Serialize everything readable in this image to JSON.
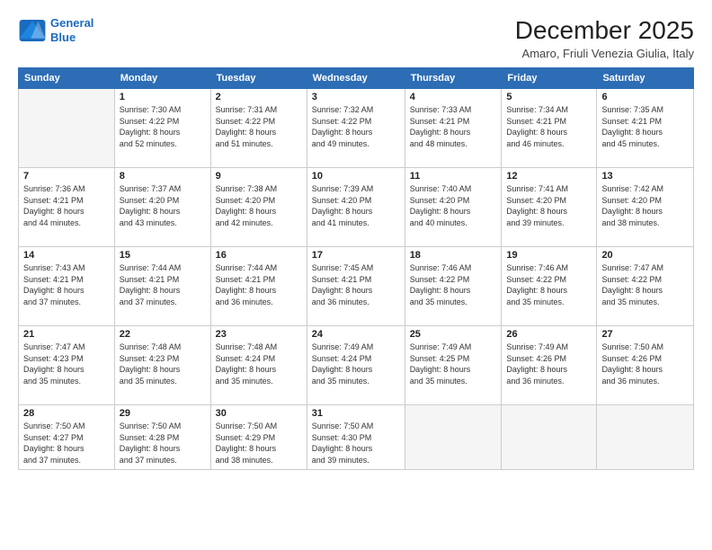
{
  "header": {
    "logo_line1": "General",
    "logo_line2": "Blue",
    "month": "December 2025",
    "location": "Amaro, Friuli Venezia Giulia, Italy"
  },
  "days_of_week": [
    "Sunday",
    "Monday",
    "Tuesday",
    "Wednesday",
    "Thursday",
    "Friday",
    "Saturday"
  ],
  "weeks": [
    [
      {
        "day": "",
        "info": ""
      },
      {
        "day": "1",
        "info": "Sunrise: 7:30 AM\nSunset: 4:22 PM\nDaylight: 8 hours\nand 52 minutes."
      },
      {
        "day": "2",
        "info": "Sunrise: 7:31 AM\nSunset: 4:22 PM\nDaylight: 8 hours\nand 51 minutes."
      },
      {
        "day": "3",
        "info": "Sunrise: 7:32 AM\nSunset: 4:22 PM\nDaylight: 8 hours\nand 49 minutes."
      },
      {
        "day": "4",
        "info": "Sunrise: 7:33 AM\nSunset: 4:21 PM\nDaylight: 8 hours\nand 48 minutes."
      },
      {
        "day": "5",
        "info": "Sunrise: 7:34 AM\nSunset: 4:21 PM\nDaylight: 8 hours\nand 46 minutes."
      },
      {
        "day": "6",
        "info": "Sunrise: 7:35 AM\nSunset: 4:21 PM\nDaylight: 8 hours\nand 45 minutes."
      }
    ],
    [
      {
        "day": "7",
        "info": "Sunrise: 7:36 AM\nSunset: 4:21 PM\nDaylight: 8 hours\nand 44 minutes."
      },
      {
        "day": "8",
        "info": "Sunrise: 7:37 AM\nSunset: 4:20 PM\nDaylight: 8 hours\nand 43 minutes."
      },
      {
        "day": "9",
        "info": "Sunrise: 7:38 AM\nSunset: 4:20 PM\nDaylight: 8 hours\nand 42 minutes."
      },
      {
        "day": "10",
        "info": "Sunrise: 7:39 AM\nSunset: 4:20 PM\nDaylight: 8 hours\nand 41 minutes."
      },
      {
        "day": "11",
        "info": "Sunrise: 7:40 AM\nSunset: 4:20 PM\nDaylight: 8 hours\nand 40 minutes."
      },
      {
        "day": "12",
        "info": "Sunrise: 7:41 AM\nSunset: 4:20 PM\nDaylight: 8 hours\nand 39 minutes."
      },
      {
        "day": "13",
        "info": "Sunrise: 7:42 AM\nSunset: 4:20 PM\nDaylight: 8 hours\nand 38 minutes."
      }
    ],
    [
      {
        "day": "14",
        "info": "Sunrise: 7:43 AM\nSunset: 4:21 PM\nDaylight: 8 hours\nand 37 minutes."
      },
      {
        "day": "15",
        "info": "Sunrise: 7:44 AM\nSunset: 4:21 PM\nDaylight: 8 hours\nand 37 minutes."
      },
      {
        "day": "16",
        "info": "Sunrise: 7:44 AM\nSunset: 4:21 PM\nDaylight: 8 hours\nand 36 minutes."
      },
      {
        "day": "17",
        "info": "Sunrise: 7:45 AM\nSunset: 4:21 PM\nDaylight: 8 hours\nand 36 minutes."
      },
      {
        "day": "18",
        "info": "Sunrise: 7:46 AM\nSunset: 4:22 PM\nDaylight: 8 hours\nand 35 minutes."
      },
      {
        "day": "19",
        "info": "Sunrise: 7:46 AM\nSunset: 4:22 PM\nDaylight: 8 hours\nand 35 minutes."
      },
      {
        "day": "20",
        "info": "Sunrise: 7:47 AM\nSunset: 4:22 PM\nDaylight: 8 hours\nand 35 minutes."
      }
    ],
    [
      {
        "day": "21",
        "info": "Sunrise: 7:47 AM\nSunset: 4:23 PM\nDaylight: 8 hours\nand 35 minutes."
      },
      {
        "day": "22",
        "info": "Sunrise: 7:48 AM\nSunset: 4:23 PM\nDaylight: 8 hours\nand 35 minutes."
      },
      {
        "day": "23",
        "info": "Sunrise: 7:48 AM\nSunset: 4:24 PM\nDaylight: 8 hours\nand 35 minutes."
      },
      {
        "day": "24",
        "info": "Sunrise: 7:49 AM\nSunset: 4:24 PM\nDaylight: 8 hours\nand 35 minutes."
      },
      {
        "day": "25",
        "info": "Sunrise: 7:49 AM\nSunset: 4:25 PM\nDaylight: 8 hours\nand 35 minutes."
      },
      {
        "day": "26",
        "info": "Sunrise: 7:49 AM\nSunset: 4:26 PM\nDaylight: 8 hours\nand 36 minutes."
      },
      {
        "day": "27",
        "info": "Sunrise: 7:50 AM\nSunset: 4:26 PM\nDaylight: 8 hours\nand 36 minutes."
      }
    ],
    [
      {
        "day": "28",
        "info": "Sunrise: 7:50 AM\nSunset: 4:27 PM\nDaylight: 8 hours\nand 37 minutes."
      },
      {
        "day": "29",
        "info": "Sunrise: 7:50 AM\nSunset: 4:28 PM\nDaylight: 8 hours\nand 37 minutes."
      },
      {
        "day": "30",
        "info": "Sunrise: 7:50 AM\nSunset: 4:29 PM\nDaylight: 8 hours\nand 38 minutes."
      },
      {
        "day": "31",
        "info": "Sunrise: 7:50 AM\nSunset: 4:30 PM\nDaylight: 8 hours\nand 39 minutes."
      },
      {
        "day": "",
        "info": ""
      },
      {
        "day": "",
        "info": ""
      },
      {
        "day": "",
        "info": ""
      }
    ]
  ]
}
